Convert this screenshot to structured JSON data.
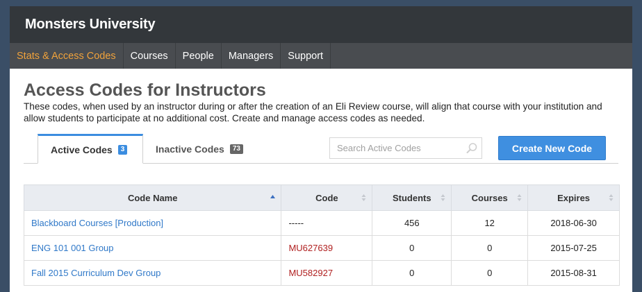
{
  "app": {
    "title": "Monsters University"
  },
  "nav": {
    "items": [
      {
        "label": "Stats & Access Codes",
        "active": true
      },
      {
        "label": "Courses",
        "active": false
      },
      {
        "label": "People",
        "active": false
      },
      {
        "label": "Managers",
        "active": false
      },
      {
        "label": "Support",
        "active": false
      }
    ]
  },
  "page": {
    "title": "Access Codes for Instructors",
    "description": "These codes, when used by an instructor during or after the creation of an Eli Review course, will align that course with your institution and allow students to participate at no additional cost. Create and manage access codes as needed."
  },
  "tabs": {
    "active": {
      "label": "Active Codes",
      "count": "3"
    },
    "inactive": {
      "label": "Inactive Codes",
      "count": "73"
    }
  },
  "search": {
    "placeholder": "Search Active Codes",
    "value": ""
  },
  "actions": {
    "new_code_label": "Create New Code"
  },
  "table": {
    "headers": {
      "code_name": "Code Name",
      "code": "Code",
      "students": "Students",
      "courses": "Courses",
      "expires": "Expires"
    },
    "rows": [
      {
        "name": "Blackboard Courses [Production]",
        "code": "-----",
        "students": "456",
        "courses": "12",
        "expires": "2018-06-30"
      },
      {
        "name": "ENG 101 001 Group",
        "code": "MU627639",
        "students": "0",
        "courses": "0",
        "expires": "2015-07-25"
      },
      {
        "name": "Fall 2015 Curriculum Dev Group",
        "code": "MU582927",
        "students": "0",
        "courses": "0",
        "expires": "2015-08-31"
      }
    ]
  },
  "colors": {
    "accent": "#3b8de0",
    "nav_active": "#f0a23b",
    "code_text": "#b02020",
    "link": "#2f78c8"
  }
}
